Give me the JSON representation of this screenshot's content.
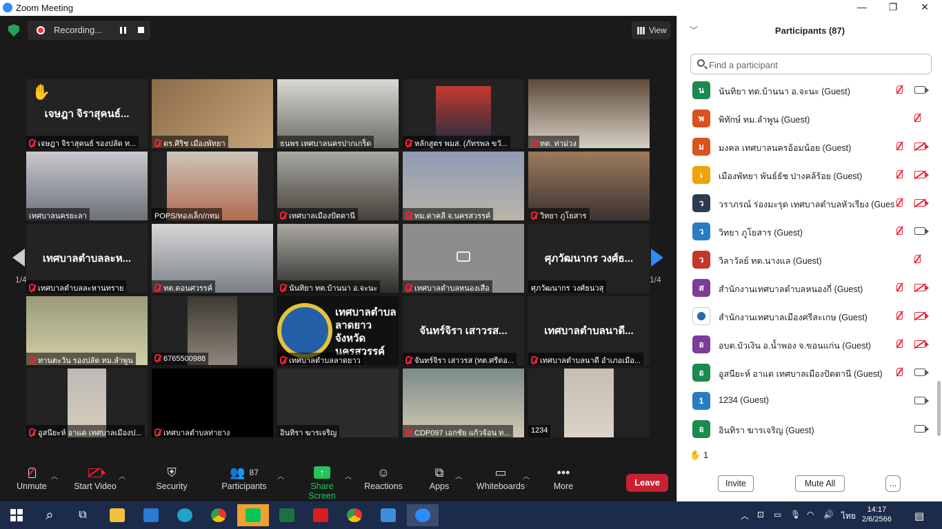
{
  "window": {
    "title": "Zoom Meeting"
  },
  "recording": {
    "label": "Recording..."
  },
  "view_label": "View",
  "pagination": {
    "left": "1/4",
    "right": "1/4"
  },
  "tiles": [
    {
      "name": "เจษฎา จิราสุคนธ์ รองปลัด ท...",
      "big": "เจษฎา จิราสุคนธ์...",
      "muted": true,
      "hand": true
    },
    {
      "name": "ดร.ศิริช เมืองพัทยา",
      "big": "",
      "muted": true
    },
    {
      "name": "ธนพร เทศบาลนครปากเกร็ด",
      "big": "",
      "muted": false,
      "selected": true
    },
    {
      "name": "หลักสูตร พมส. (ภัทรพล ขวั...",
      "big": "",
      "muted": true
    },
    {
      "name": "ทต. ท่าม่วง",
      "big": "",
      "muted": true
    },
    {
      "name": "เทศบาลนครยะลา",
      "big": "",
      "muted": false
    },
    {
      "name": "POPS/ทองเล็ก/กทม",
      "big": "",
      "muted": false
    },
    {
      "name": "เทศบาลเมืองปัตตานี",
      "big": "",
      "muted": true
    },
    {
      "name": "ทม.ตาคลี จ.นครสวรรค์",
      "big": "",
      "muted": true
    },
    {
      "name": "วิทยา ภูโยสาร",
      "big": "",
      "muted": true
    },
    {
      "name": "เทศบาลตำบลละหานทราย",
      "big": "เทศบาลตำบลละห...",
      "muted": true
    },
    {
      "name": "ทต.ดอนศวรรค์",
      "big": "",
      "muted": true
    },
    {
      "name": "นันทิยา ทต.บ้านนา อ.จะนะ",
      "big": "",
      "muted": true
    },
    {
      "name": "เทศบาลตำบลหนองเสือ",
      "big": "",
      "muted": true,
      "videooff": true
    },
    {
      "name": "ศุภวัฒนากร วงศ์ธนวสุ",
      "big": "ศุภวัฒนากร วงศ์ธ...",
      "muted": false
    },
    {
      "name": "ทานตะวัน รองปลัด ทม.ลำพูน",
      "big": "",
      "muted": true
    },
    {
      "name": "6765500988",
      "big": "",
      "muted": true
    },
    {
      "name": "เทศบาลตำบลลาดยาว",
      "big": "",
      "muted": true,
      "logo_text": "เทศบาลตำบล ลาดยาว จังหวัดนครสวรรค์"
    },
    {
      "name": "จันทร์จิรา เสาวรส (ทต.ศรีดอ...",
      "big": "จันทร์จิรา เสาวรส...",
      "muted": true
    },
    {
      "name": "เทศบาลตำบลนาดี อำเภอเมือ...",
      "big": "เทศบาลตำบลนาดี...",
      "muted": true
    },
    {
      "name": "อูสนียะห์ อาแด เทศบาลเมืองป...",
      "big": "",
      "muted": true
    },
    {
      "name": "เทศบาลตำบลท่ายาง",
      "big": "",
      "muted": true
    },
    {
      "name": "อินทิรา ฆารเจริญ",
      "big": "",
      "muted": false
    },
    {
      "name": "CDP097 เอกชัย แก้วจ้อน ท...",
      "big": "",
      "muted": true
    },
    {
      "name": "1234",
      "big": "",
      "muted": false
    }
  ],
  "toolbar": {
    "unmute": "Unmute",
    "start_video": "Start Video",
    "security": "Security",
    "participants": "Participants",
    "participants_count": "87",
    "share_screen": "Share Screen",
    "reactions": "Reactions",
    "apps": "Apps",
    "whiteboards": "Whiteboards",
    "more": "More",
    "leave": "Leave"
  },
  "panel": {
    "title": "Participants (87)",
    "search_placeholder": "Find a participant",
    "participants": [
      {
        "initial": "น",
        "color": "#1a8a4e",
        "name": "นันทิยา ทต.บ้านนา อ.จะนะ (Guest)",
        "mic_off": true,
        "video_off": false
      },
      {
        "initial": "พ",
        "color": "#d9531e",
        "name": "พิทักษ์ ทม.ลำพูน (Guest)",
        "mic_off": true,
        "video_off": null
      },
      {
        "initial": "ม",
        "color": "#d9531e",
        "name": "มงคล เทศบาลนครอ้อมน้อย (Guest)",
        "mic_off": true,
        "video_off": true
      },
      {
        "initial": "เ",
        "color": "#f0a20a",
        "name": "เมืองพัทยา พันธ์ธัช ปางคล้ร้อย (Guest)",
        "mic_off": true,
        "video_off": true
      },
      {
        "initial": "ว",
        "color": "#2d3b4f",
        "name": "วราภรณ์ ร่องมะรุด เทศบาลตำบลหัวเรียง (Guest)",
        "mic_off": true,
        "video_off": true
      },
      {
        "initial": "ว",
        "color": "#2a7bc4",
        "name": "วิทยา ภูโยสาร (Guest)",
        "mic_off": true,
        "video_off": false
      },
      {
        "initial": "ว",
        "color": "#c0392b",
        "name": "วิลาวัลย์ ทต.นางแล (Guest)",
        "mic_off": true,
        "video_off": null
      },
      {
        "initial": "ส",
        "color": "#7d3c98",
        "name": "สำนักงานเทศบาลตำบลหนองกี่ (Guest)",
        "mic_off": true,
        "video_off": true
      },
      {
        "initial": "",
        "color": "#ffffff",
        "name": "สำนักงานเทศบาลเมืองศรีสะเกษ (Guest)",
        "mic_off": true,
        "video_off": true,
        "logo": true
      },
      {
        "initial": "อ",
        "color": "#7d3c98",
        "name": "อบต.บัวเงิน อ.น้ำพอง จ.ขอนแก่น (Guest)",
        "mic_off": true,
        "video_off": true
      },
      {
        "initial": "อ",
        "color": "#1a8a4e",
        "name": "อูสนียะห์ อาแด เทศบาลเมืองปัตตานี (Guest)",
        "mic_off": true,
        "video_off": false
      },
      {
        "initial": "1",
        "color": "#2a7bc4",
        "name": "1234 (Guest)",
        "mic_off": false,
        "video_off": false
      },
      {
        "initial": "อ",
        "color": "#1a8a4e",
        "name": "อินทิรา ฆารเจริญ (Guest)",
        "mic_off": false,
        "video_off": false
      }
    ],
    "raised_hands": "1",
    "invite": "Invite",
    "mute_all": "Mute All",
    "more": "..."
  },
  "taskbar": {
    "time": "14:17",
    "date": "2/6/2566",
    "lang": "ไทย"
  }
}
